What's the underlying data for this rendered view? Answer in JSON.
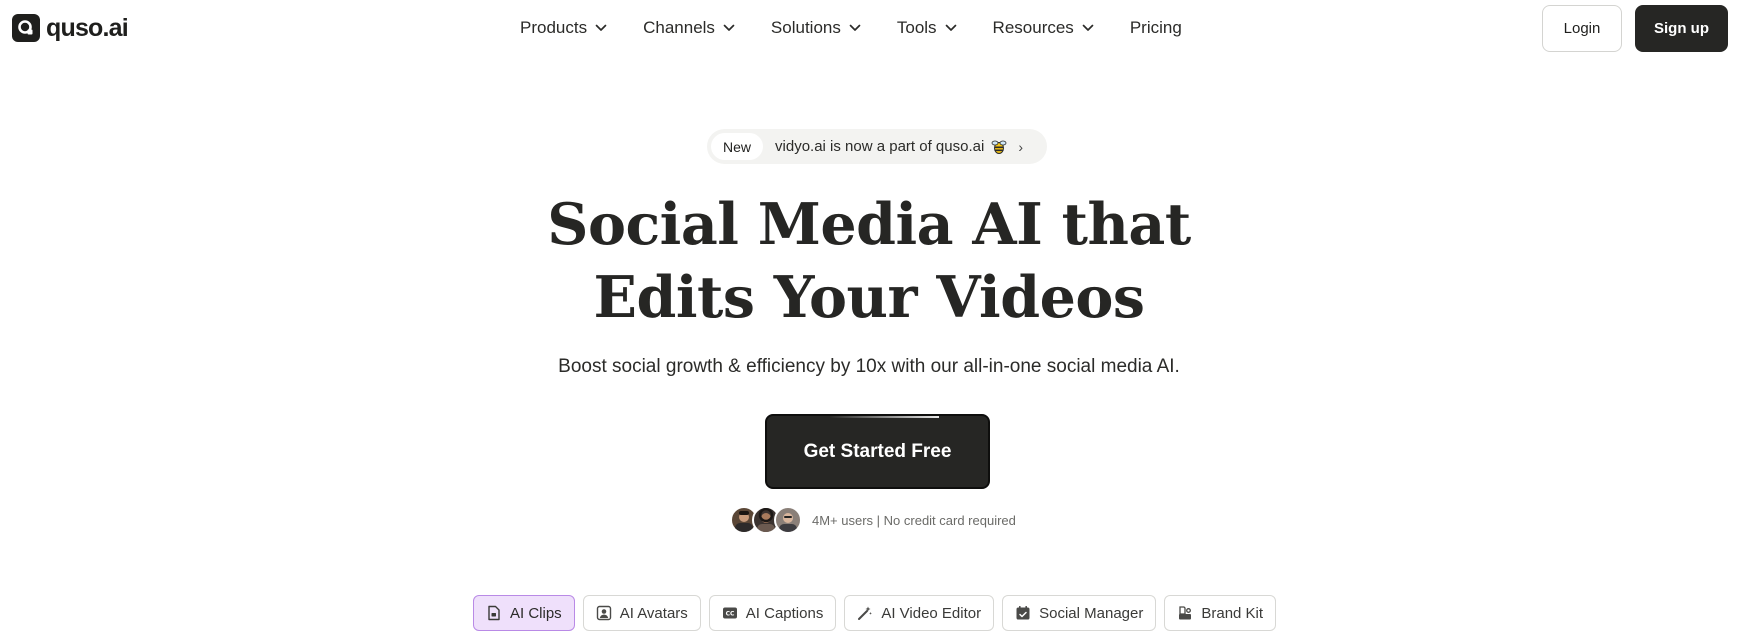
{
  "header": {
    "logo_text": "quso.ai",
    "nav": [
      {
        "label": "Products",
        "has_dropdown": true
      },
      {
        "label": "Channels",
        "has_dropdown": true
      },
      {
        "label": "Solutions",
        "has_dropdown": true
      },
      {
        "label": "Tools",
        "has_dropdown": true
      },
      {
        "label": "Resources",
        "has_dropdown": true
      },
      {
        "label": "Pricing",
        "has_dropdown": false
      }
    ],
    "login_label": "Login",
    "signup_label": "Sign up"
  },
  "announcement": {
    "badge": "New",
    "text": "vidyo.ai is now a part of quso.ai",
    "emoji_icon": "sparkle-bee-icon",
    "arrow": "›"
  },
  "hero": {
    "title_line1": "Social Media AI that",
    "title_line2": "Edits Your Videos",
    "subtitle": "Boost social growth & efficiency by 10x with our all-in-one social media AI.",
    "cta_label": "Get Started Free",
    "social_proof": "4M+ users | No credit card required"
  },
  "feature_tabs": [
    {
      "label": "AI Clips",
      "icon": "clip-file-icon",
      "active": true
    },
    {
      "label": "AI Avatars",
      "icon": "avatar-icon",
      "active": false
    },
    {
      "label": "AI Captions",
      "icon": "cc-icon",
      "active": false
    },
    {
      "label": "AI Video Editor",
      "icon": "magic-wand-icon",
      "active": false
    },
    {
      "label": "Social Manager",
      "icon": "calendar-check-icon",
      "active": false
    },
    {
      "label": "Brand Kit",
      "icon": "brand-kit-icon",
      "active": false
    }
  ],
  "colors": {
    "primary_dark": "#262624",
    "active_tab_bg": "#efe0fb",
    "active_tab_border": "#b98ae6",
    "pill_bg": "#f3f3f1"
  }
}
